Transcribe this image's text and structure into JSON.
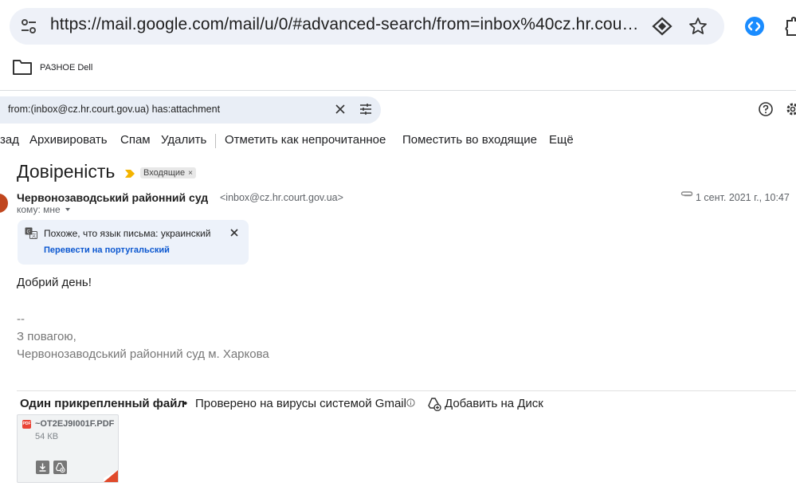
{
  "browser": {
    "url": "https://mail.google.com/mail/u/0/#advanced-search/from=inbox%40cz.hr.court.go...",
    "bookmarks": [
      {
        "label": "РАЗНОЕ Dell",
        "icon": "folder-icon"
      }
    ]
  },
  "search": {
    "query": "from:(inbox@cz.hr.court.gov.ua) has:attachment"
  },
  "toolbar": {
    "back": "зад",
    "archive": "Архивировать",
    "spam": "Спам",
    "delete": "Удалить",
    "mark_unread": "Отметить как непрочитанное",
    "move_inbox": "Поместить во входящие",
    "more": "Ещё"
  },
  "message": {
    "subject": "Довіреність",
    "label": "Входящие",
    "label_close": "×",
    "sender_name": "Червонозаводський районний суд",
    "sender_email": "<inbox@cz.hr.court.gov.ua>",
    "to": "кому: мне",
    "date": "1 сент. 2021 г., 10:47",
    "translate": {
      "notice": "Похоже, что язык письма: украинский",
      "link": "Перевести на португальский"
    },
    "greeting": "Добрий день!",
    "signature": {
      "dash": "--",
      "line1": "З повагою,",
      "line2": "Червонозаводський районний суд м. Харкова"
    }
  },
  "attachments": {
    "title": "Один прикрепленный файл",
    "dot": "•",
    "scan_note": "Проверено на вирусы системой Gmail",
    "add_to_drive": "Добавить на Диск",
    "files": [
      {
        "name": "~OT2EJ9I001F.PDF",
        "size": "54 КВ",
        "badge": "PDF"
      }
    ]
  },
  "colors": {
    "accent": "#0b57d0",
    "avatar": "#c0461e",
    "important": "#f4b400",
    "pdf": "#ea4335"
  }
}
